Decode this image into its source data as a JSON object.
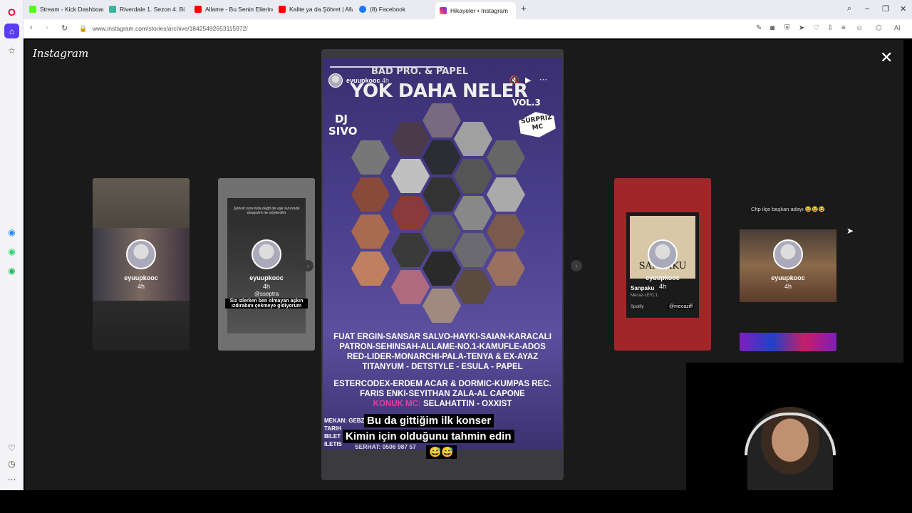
{
  "tabs": [
    {
      "label": "Stream - Kick Dashboard",
      "color": "#53fc18"
    },
    {
      "label": "Riverdale 1. Sezon 4. Bölü",
      "color": "#3ab5a0"
    },
    {
      "label": "Allame - Bu Senin Ellerind",
      "color": "#ff0000"
    },
    {
      "label": "Kalite ya da Şöhret | Allam",
      "color": "#ff0000"
    },
    {
      "label": "(8) Facebook",
      "color": "#1877f2"
    },
    {
      "label": "Hikayeler • Instagram",
      "color": "#d6249f"
    }
  ],
  "address": {
    "url": "www.instagram.com/stories/archive/18425492653115972/"
  },
  "viewer": {
    "logo": "Instagram",
    "side_cards": [
      {
        "name": "eyuupkooc",
        "time": "4h"
      },
      {
        "name": "eyuupkooc",
        "time": "4h",
        "handle": "@sseptra",
        "caption": "Siz izlerken ben olmayan aşkın ızdırabını çekmeye gidiyorum",
        "top_text": "Şöhret sınırında değil de aşk sınırında olsaydım ne söylerdim"
      },
      {
        "name": "eyuupkooc",
        "time": "4h",
        "song": "Sanpaku",
        "artist": "Mecaz-LEYL'L",
        "spotify": "Spotify",
        "handle": "@mecaziff",
        "album_word": "SANPAKU"
      },
      {
        "name": "eyuupkooc",
        "time": "4h",
        "top_text": "Chp ilçe başkan adayı 😂😂😂"
      }
    ],
    "main": {
      "username": "eyuupkooc",
      "time": "4h",
      "header_small": "BAD PRO. & PAPEL",
      "title": "YOK DAHA NELER",
      "vol": "VOL.3",
      "dj": "DJ SIVO",
      "surpriz": "SURPRIZ MC",
      "lineup_1": [
        "FUAT ERGIN-SANSAR SALVO-HAYKI-SAIAN-KARACALI",
        "PATRON-SEHINSAH-ALLAME-NO.1-KAMUFLE-ADOS",
        "RED-LIDER-MONARCHI-PALA-TENYA & EX-AYAZ",
        "TITANYUM - DETSTYLE - ESULA - PAPEL"
      ],
      "lineup_2": [
        "ESTERCODEX-ERDEM ACAR & DORMIC-KUMPAS REC.",
        "FARIS ENKI-SEYITHAN ZALA-AL CAPONE"
      ],
      "konuk": "KONUK MC:",
      "konuk_names": "SELAHATTIN - OXXIST",
      "info_labels": [
        "MEKAN: GEBZ",
        "TARIH",
        "BILET",
        "ILETIS"
      ],
      "phone": "SERHAT: 0506 987 57",
      "caption_1": "Bu da gittiğim ilk konser",
      "caption_2": "Kimin için olduğunu tahmin edin",
      "caption_3": "😅😅"
    }
  }
}
